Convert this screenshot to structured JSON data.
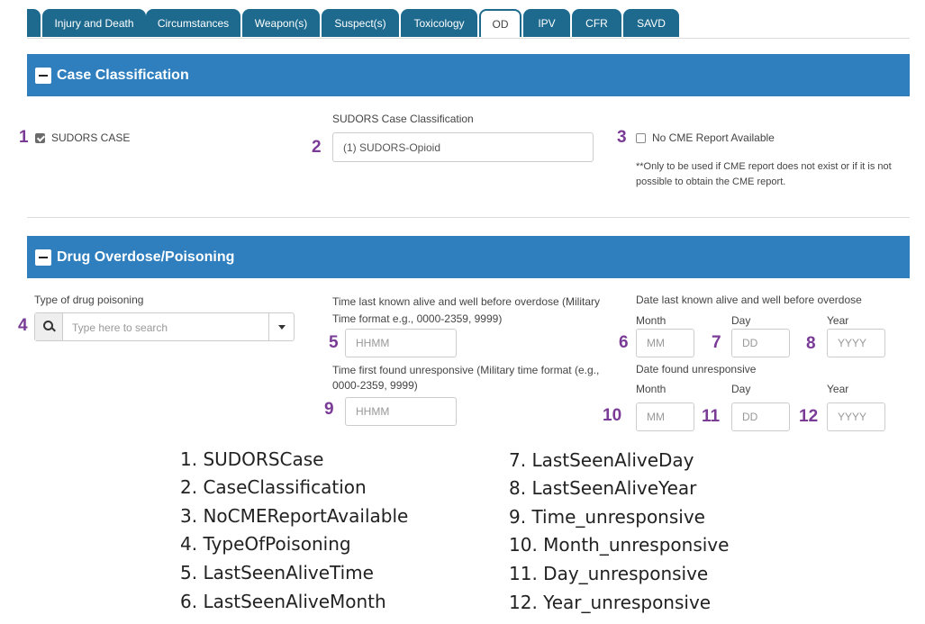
{
  "tabs": [
    "Injury and Death",
    "Circumstances",
    "Weapon(s)",
    "Suspect(s)",
    "Toxicology",
    "OD",
    "IPV",
    "CFR",
    "SAVD"
  ],
  "active_tab": "OD",
  "case_classification": {
    "title": "Case Classification",
    "sudors_case_label": "SUDORS CASE",
    "sudors_case_checked": true,
    "classification_label": "SUDORS Case Classification",
    "classification_value": "(1) SUDORS-Opioid",
    "no_cme_label": "No CME Report Available",
    "no_cme_checked": false,
    "no_cme_note": "**Only to be used if CME report does not exist or if it is not possible to obtain the CME report."
  },
  "drug_overdose": {
    "title": "Drug Overdose/Poisoning",
    "type_label": "Type of drug poisoning",
    "type_placeholder": "Type here to search",
    "time_alive_label": "Time last known alive and well before overdose (Military Time format e.g., 0000-2359, 9999)",
    "time_alive_placeholder": "HHMM",
    "time_found_label": "Time first found unresponsive (Military time format (e.g., 0000-2359, 9999)",
    "time_found_placeholder": "HHMM",
    "date_alive_label": "Date last known alive and well before overdose",
    "date_found_label": "Date found unresponsive",
    "month_label": "Month",
    "day_label": "Day",
    "year_label": "Year",
    "month_placeholder": "MM",
    "day_placeholder": "DD",
    "year_placeholder": "YYYY"
  },
  "markers": [
    "1",
    "2",
    "3",
    "4",
    "5",
    "6",
    "7",
    "8",
    "9",
    "10",
    "11",
    "12"
  ],
  "legend": [
    "1.   SUDORSCase",
    "2.   CaseClassification",
    "3.   NoCMEReportAvailable",
    "4.   TypeOfPoisoning",
    "5.   LastSeenAliveTime",
    "6.   LastSeenAliveMonth",
    "7.   LastSeenAliveDay",
    "8.   LastSeenAliveYear",
    "9.   Time_unresponsive",
    "10. Month_unresponsive",
    "11. Day_unresponsive",
    "12. Year_unresponsive"
  ],
  "colors": {
    "tab": "#1d6a8e",
    "section_header": "#2f7fbf",
    "marker": "#7a3b96"
  }
}
